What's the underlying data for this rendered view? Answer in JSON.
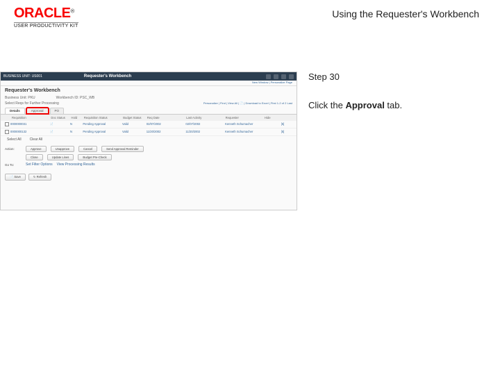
{
  "header": {
    "logo_text": "ORACLE",
    "trademark": "®",
    "subtitle": "USER PRODUCTIVITY KIT",
    "main_title": "Using the Requester's Workbench"
  },
  "instructions": {
    "step_label": "Step 30",
    "body_prefix": "Click the ",
    "body_bold": "Approval",
    "body_suffix": " tab."
  },
  "screenshot": {
    "topbar": {
      "brand": "BUSINESS UNIT: US001",
      "title": "Requester's Workbench"
    },
    "subbar_links": "New Window | Personalize Page",
    "page_heading": "Requester's Workbench",
    "filter1_label": "Business Unit:",
    "filter1_value": "PKU",
    "filter2_label": "Workbench ID:",
    "filter2_value": "PSC_WB",
    "section_label": "Select Reqs for Further Processing",
    "grid_controls": "Personalize | Find | View All | 📄 | Download to Excel | First   1-2 of 2   Last",
    "tabs": [
      "Details",
      "Approval",
      "PO"
    ],
    "columns": [
      "",
      "Requisition",
      "Doc Status",
      "Hold",
      "Requisition Status",
      "Budget Status",
      "Req Date",
      "Last Activity",
      "Requester",
      "Hide",
      ""
    ],
    "rows": [
      {
        "req": "0000000031",
        "doc": "📄",
        "hold": "N",
        "status": "Pending Approval",
        "budget": "Valid",
        "date": "02/07/2002",
        "activity": "02/07/2002",
        "requester": "Kenneth Schumacher",
        "btn": "[5]"
      },
      {
        "req": "0000000132",
        "doc": "📄",
        "hold": "N",
        "status": "Pending Approval",
        "budget": "Valid",
        "date": "11/20/2002",
        "activity": "11/20/2002",
        "requester": "Kenneth Schumacher",
        "btn": "[5]"
      }
    ],
    "select_all_label": "Select All",
    "clear_all_label": "Clear All",
    "actions": {
      "row1_label": "Action:",
      "row1_btns": [
        "Approve",
        "Unapprove",
        "Cancel",
        "Send Approval Reminder"
      ],
      "row2_btns": [
        "Close",
        "Update Lines",
        "Budget Pre-Check"
      ],
      "row3_label": "Go To:",
      "row3_btns": [
        "Set Filter Options",
        "View Processing Results"
      ]
    },
    "footer_btns": [
      "📄 Save",
      "↻ Refresh"
    ]
  }
}
